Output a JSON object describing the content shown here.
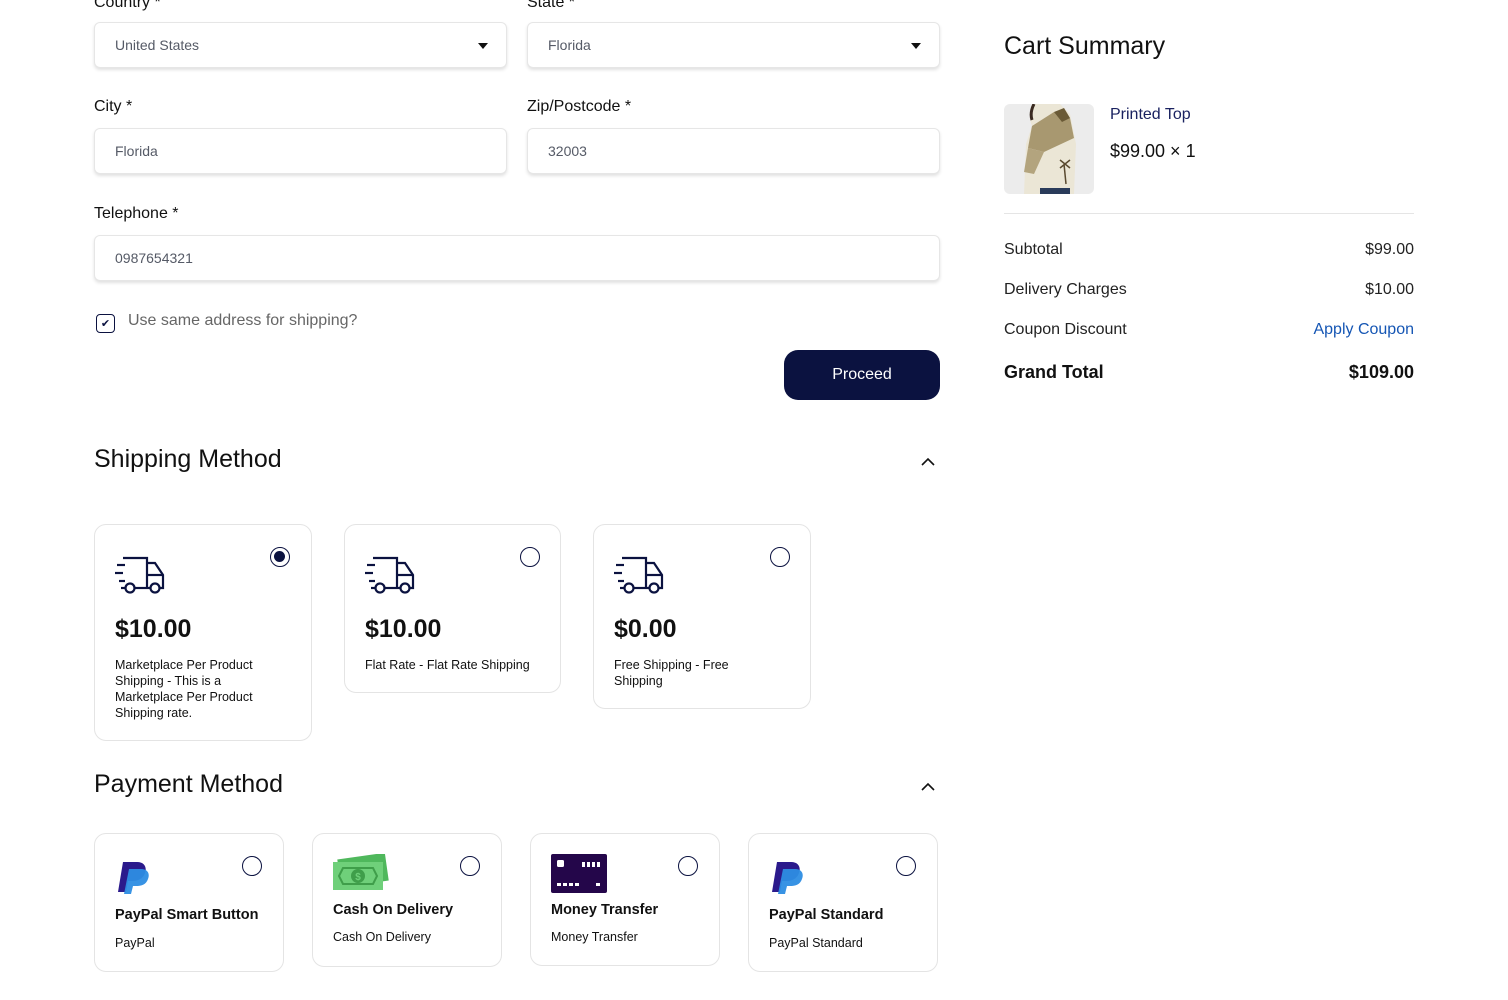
{
  "address_form": {
    "country": {
      "label": "Country *",
      "value": "United States"
    },
    "state": {
      "label": "State *",
      "value": "Florida"
    },
    "city": {
      "label": "City *",
      "value": "Florida"
    },
    "zip": {
      "label": "Zip/Postcode *",
      "value": "32003"
    },
    "telephone": {
      "label": "Telephone *",
      "value": "0987654321"
    },
    "same_address": {
      "label": "Use same address for shipping?",
      "checked": true
    },
    "proceed_label": "Proceed"
  },
  "shipping": {
    "title": "Shipping Method",
    "options": [
      {
        "price": "$10.00",
        "description": "Marketplace Per Product Shipping - This is a Marketplace Per Product Shipping rate.",
        "selected": true,
        "icon": "truck-icon"
      },
      {
        "price": "$10.00",
        "description": "Flat Rate - Flat Rate Shipping",
        "selected": false,
        "icon": "truck-icon"
      },
      {
        "price": "$0.00",
        "description": "Free Shipping - Free Shipping",
        "selected": false,
        "icon": "truck-icon"
      }
    ]
  },
  "payment": {
    "title": "Payment Method",
    "options": [
      {
        "title": "PayPal Smart Button",
        "subtitle": "PayPal",
        "icon": "paypal-icon",
        "selected": false
      },
      {
        "title": "Cash On Delivery",
        "subtitle": "Cash On Delivery",
        "icon": "cash-icon",
        "selected": false
      },
      {
        "title": "Money Transfer",
        "subtitle": "Money Transfer",
        "icon": "card-icon",
        "selected": false
      },
      {
        "title": "PayPal Standard",
        "subtitle": "PayPal Standard",
        "icon": "paypal-icon",
        "selected": false
      }
    ]
  },
  "cart": {
    "title": "Cart Summary",
    "item": {
      "name": "Printed Top",
      "price_qty": "$99.00 × 1"
    },
    "subtotal": {
      "label": "Subtotal",
      "value": "$99.00"
    },
    "delivery": {
      "label": "Delivery Charges",
      "value": "$10.00"
    },
    "coupon": {
      "label": "Coupon Discount",
      "action": "Apply Coupon"
    },
    "grand_total": {
      "label": "Grand Total",
      "value": "$109.00"
    }
  },
  "colors": {
    "primary": "#0b1240",
    "link": "#1556b4",
    "paypal_dark": "#2b1a8c",
    "paypal_light": "#2d8de3",
    "cash_green": "#5cc46a",
    "card_purple": "#24064a"
  }
}
